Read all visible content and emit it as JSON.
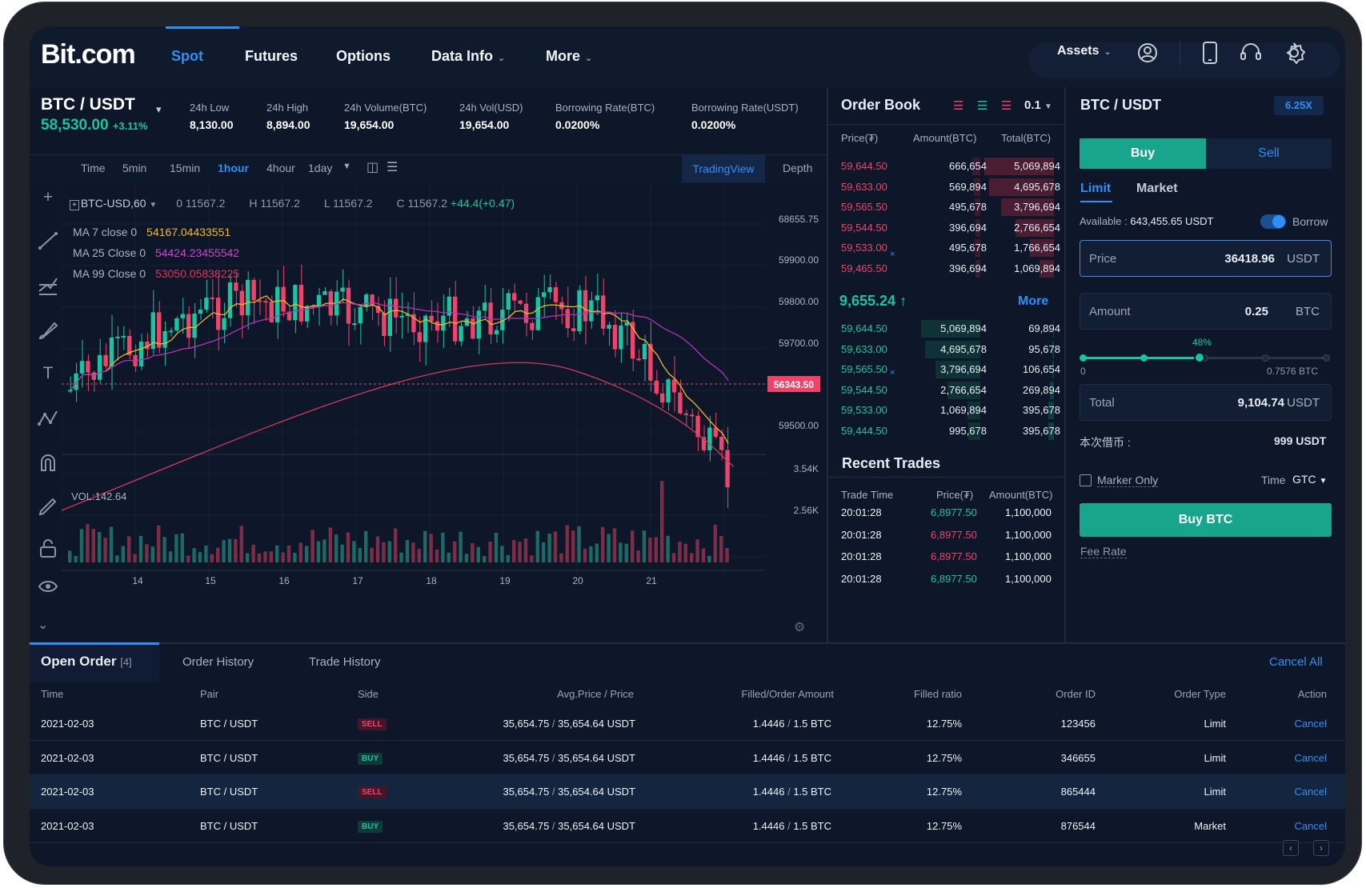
{
  "nav": {
    "logo": "Bit.com",
    "items": [
      "Spot",
      "Futures",
      "Options",
      "Data Info",
      "More"
    ],
    "active": "Spot",
    "assets": "Assets"
  },
  "ticker": {
    "pair": "BTC / USDT",
    "price": "58,530.00",
    "change": "+3.11%",
    "stats": [
      {
        "label": "24h Low",
        "value": "8,130.00"
      },
      {
        "label": "24h High",
        "value": "8,894.00"
      },
      {
        "label": "24h Volume(BTC)",
        "value": "19,654.00"
      },
      {
        "label": "24h Vol(USD)",
        "value": "19,654.00"
      },
      {
        "label": "Borrowing Rate(BTC)",
        "value": "0.0200%"
      },
      {
        "label": "Borrowing Rate(USDT)",
        "value": "0.0200%"
      }
    ]
  },
  "chart_toolbar": {
    "time": "Time",
    "intervals": [
      "5min",
      "15min",
      "1hour",
      "4hour",
      "1day"
    ],
    "active": "1hour",
    "views": [
      "TradingView",
      "Depth"
    ]
  },
  "chart_data": {
    "type": "candlestick",
    "symbol": "BTC-USD,60",
    "ohlc": {
      "o": "0 11567.2",
      "h": "H 11567.2",
      "l": "L 11567.2",
      "c": "C 11567.2",
      "chg": "+44.4(+0.47)"
    },
    "indicators": [
      {
        "label": "MA 7 close 0",
        "value": "54167.04433551",
        "color": "#f2b827"
      },
      {
        "label": "MA 25 Close 0",
        "value": "54424.23455542",
        "color": "#d63fd0"
      },
      {
        "label": "MA 99 Close 0",
        "value": "53050.05838225",
        "color": "#e0335c"
      }
    ],
    "y_ticks": [
      "68655.75",
      "59900.00",
      "59800.00",
      "59700.00",
      "59500.00"
    ],
    "current_price_label": "56343.50",
    "volume_label": "VOL:142.64",
    "volume_ticks": [
      "3.54K",
      "2.56K"
    ],
    "x_ticks": [
      "14",
      "15",
      "16",
      "17",
      "18",
      "19",
      "20",
      "21"
    ]
  },
  "order_book": {
    "title": "Order Book",
    "precision": "0.1",
    "headers": [
      "Price(₮)",
      "Amount(BTC)",
      "Total(BTC)"
    ],
    "asks": [
      [
        "59,644.50",
        "666,654",
        "5,069,894"
      ],
      [
        "59,633.00",
        "569,894",
        "4,695,678"
      ],
      [
        "59,565.50",
        "495,678",
        "3,796,694"
      ],
      [
        "59,544.50",
        "396,694",
        "2,766,654"
      ],
      [
        "59,533.00",
        "495,678",
        "1,766,654"
      ],
      [
        "59,465.50",
        "396,694",
        "1,069,894"
      ]
    ],
    "mid_price": "9,655.24",
    "more": "More",
    "bids": [
      [
        "59,644.50",
        "5,069,894",
        "69,894"
      ],
      [
        "59,633.00",
        "4,695,678",
        "95,678"
      ],
      [
        "59,565.50",
        "3,796,694",
        "106,654"
      ],
      [
        "59,544.50",
        "2,766,654",
        "269,894"
      ],
      [
        "59,533.00",
        "1,069,894",
        "395,678"
      ],
      [
        "59,444.50",
        "995,678",
        "395,678"
      ]
    ]
  },
  "recent_trades": {
    "title": "Recent Trades",
    "headers": [
      "Trade Time",
      "Price(₮)",
      "Amount(BTC)"
    ],
    "rows": [
      [
        "20:01:28",
        "6,8977.50",
        "1,100,000",
        "buy"
      ],
      [
        "20:01:28",
        "6,8977.50",
        "1,100,000",
        "sell"
      ],
      [
        "20:01:28",
        "6,8977.50",
        "1,100,000",
        "sell"
      ],
      [
        "20:01:28",
        "6,8977.50",
        "1,100,000",
        "buy"
      ]
    ]
  },
  "trade_form": {
    "pair": "BTC / USDT",
    "leverage": "6.25X",
    "buy": "Buy",
    "sell": "Sell",
    "limit": "Limit",
    "market": "Market",
    "available_label": "Available :",
    "available_value": "643,455.65 USDT",
    "borrow": "Borrow",
    "price_label": "Price",
    "price_value": "36418.96",
    "price_unit": "USDT",
    "amount_label": "Amount",
    "amount_value": "0.25",
    "amount_unit": "BTC",
    "slider_pct": "48%",
    "slider_value": 0.48,
    "slider_min": "0",
    "slider_max": "0.7576 BTC",
    "total_label": "Total",
    "total_value": "9,104.74",
    "total_unit": "USDT",
    "borrow_label": "本次借币 :",
    "borrow_value": "999 USDT",
    "maker_only": "Marker Only",
    "time_label": "Time",
    "time_value": "GTC",
    "submit": "Buy BTC",
    "fee_rate": "Fee Rate"
  },
  "orders": {
    "tabs": [
      "Open Order",
      "Order History",
      "Trade History"
    ],
    "open_count": "[4]",
    "cancel_all": "Cancel All",
    "headers": [
      "Time",
      "Pair",
      "Side",
      "Avg.Price / Price",
      "Filled/Order Amount",
      "Filled ratio",
      "Order ID",
      "Order Type",
      "Action"
    ],
    "rows": [
      {
        "time": "2021-02-03",
        "pair": "BTC / USDT",
        "side": "SELL",
        "avg": "35,654.75",
        "price": "35,654.64 USDT",
        "filled": "1.4446",
        "amount": "1.5 BTC",
        "ratio": "12.75%",
        "id": "123456",
        "type": "Limit",
        "action": "Cancel"
      },
      {
        "time": "2021-02-03",
        "pair": "BTC / USDT",
        "side": "BUY",
        "avg": "35,654.75",
        "price": "35,654.64 USDT",
        "filled": "1.4446",
        "amount": "1.5 BTC",
        "ratio": "12.75%",
        "id": "346655",
        "type": "Limit",
        "action": "Cancel"
      },
      {
        "time": "2021-02-03",
        "pair": "BTC / USDT",
        "side": "SELL",
        "avg": "35,654.75",
        "price": "35,654.64 USDT",
        "filled": "1.4446",
        "amount": "1.5 BTC",
        "ratio": "12.75%",
        "id": "865444",
        "type": "Limit",
        "action": "Cancel"
      },
      {
        "time": "2021-02-03",
        "pair": "BTC / USDT",
        "side": "BUY",
        "avg": "35,654.75",
        "price": "35,654.64 USDT",
        "filled": "1.4446",
        "amount": "1.5 BTC",
        "ratio": "12.75%",
        "id": "876544",
        "type": "Market",
        "action": "Cancel"
      }
    ]
  },
  "colors": {
    "up": "#19c4a2",
    "down": "#f0436a",
    "accent": "#2f8ff7",
    "bg": "#0d1729"
  }
}
